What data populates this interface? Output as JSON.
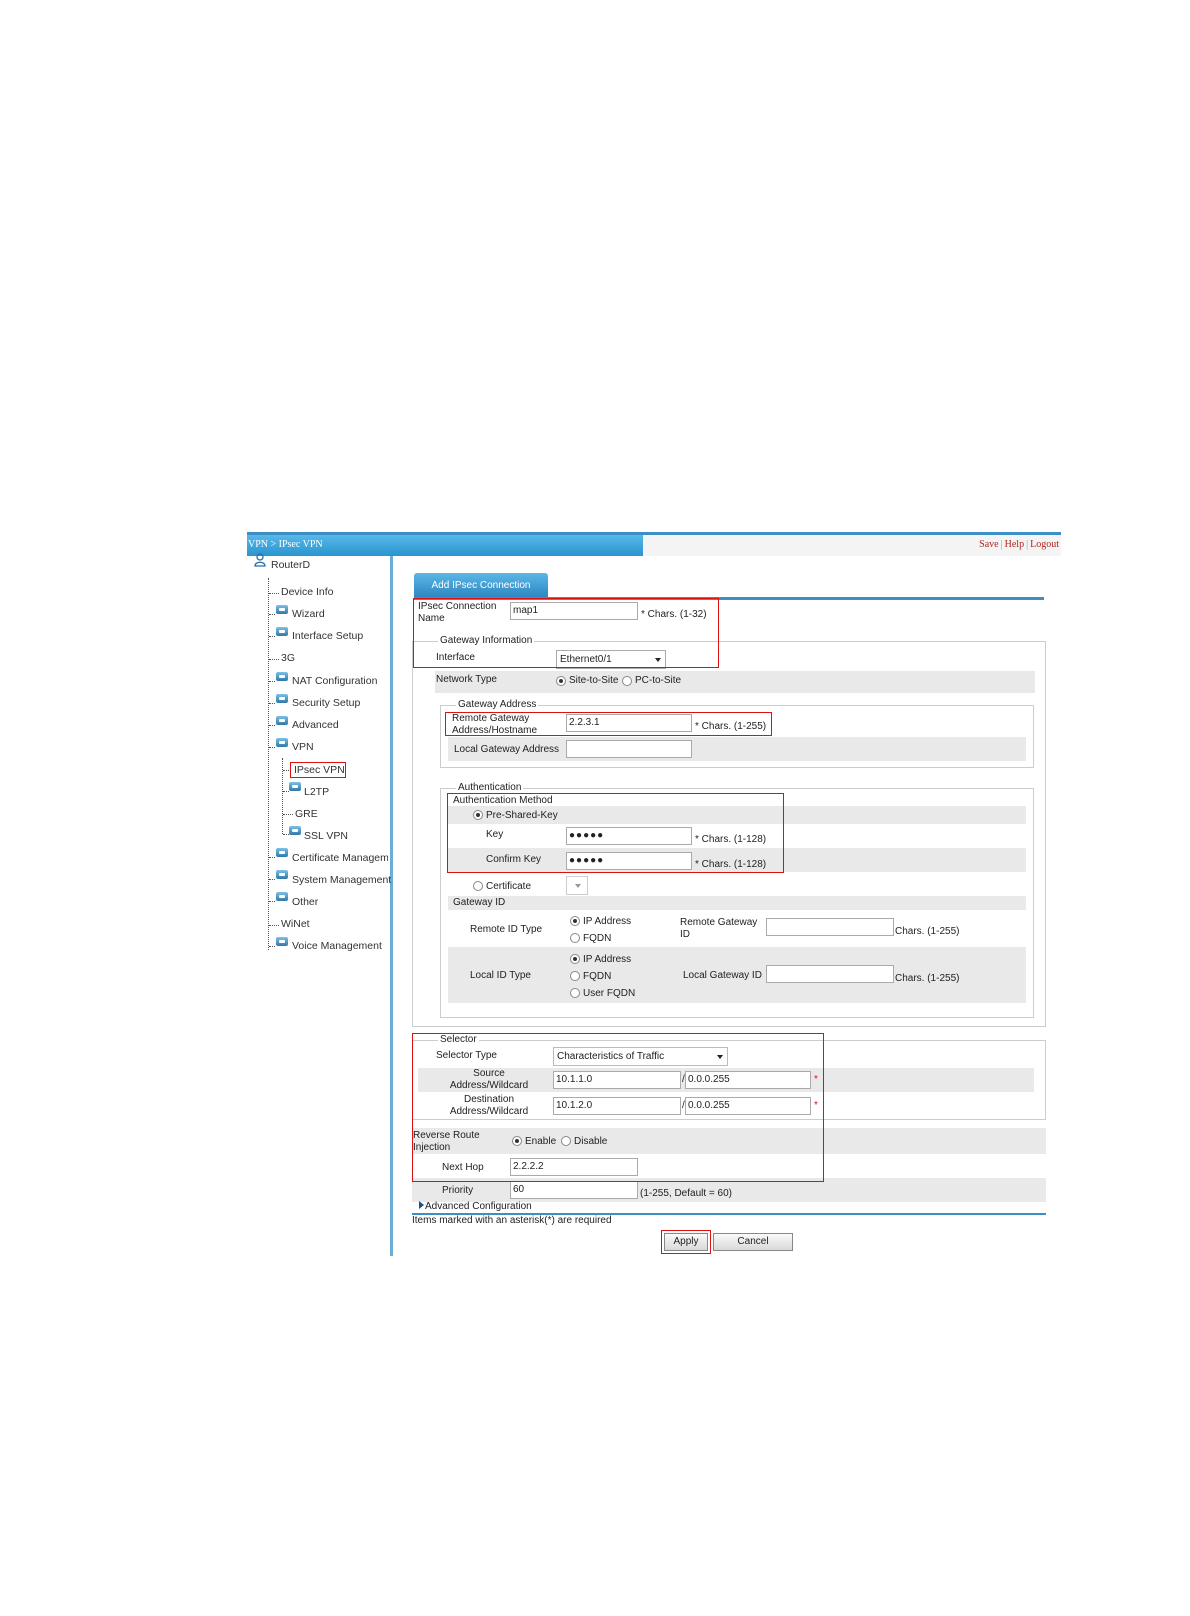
{
  "topbar": {
    "breadcrumb": "VPN > IPsec VPN",
    "links": [
      "Save",
      "Help",
      "Logout"
    ]
  },
  "sidebar": {
    "root": "RouterD",
    "items": [
      {
        "label": "Device Info"
      },
      {
        "label": "Wizard",
        "icon": "folder-icon"
      },
      {
        "label": "Interface Setup",
        "icon": "folder-icon"
      },
      {
        "label": "3G"
      },
      {
        "label": "NAT Configuration",
        "icon": "folder-icon"
      },
      {
        "label": "Security Setup",
        "icon": "folder-icon"
      },
      {
        "label": "Advanced",
        "icon": "folder-icon"
      },
      {
        "label": "VPN",
        "icon": "folder-icon"
      },
      {
        "label": "IPsec VPN",
        "selected": true
      },
      {
        "label": "L2TP",
        "icon": "folder-icon"
      },
      {
        "label": "GRE"
      },
      {
        "label": "SSL VPN",
        "icon": "folder-icon"
      },
      {
        "label": "Certificate Manageme",
        "icon": "folder-icon"
      },
      {
        "label": "System Management",
        "icon": "folder-icon"
      },
      {
        "label": "Other",
        "icon": "folder-icon"
      },
      {
        "label": "WiNet"
      },
      {
        "label": "Voice Management",
        "icon": "folder-icon"
      }
    ]
  },
  "tab": {
    "label": "Add IPsec Connection"
  },
  "form": {
    "conn_name": {
      "label": "IPsec Connection Name",
      "value": "map1",
      "hint": "* Chars. (1-32)"
    },
    "gateway_info": {
      "legend": "Gateway Information"
    },
    "interface": {
      "label": "Interface",
      "value": "Ethernet0/1"
    },
    "network_type": {
      "label": "Network Type",
      "opt1": "Site-to-Site",
      "opt2": "PC-to-Site"
    },
    "gateway_address": {
      "legend": "Gateway Address"
    },
    "remote_gw": {
      "label": "Remote Gateway Address/Hostname",
      "value": "2.2.3.1",
      "hint": "* Chars. (1-255)"
    },
    "local_gw": {
      "label": "Local Gateway Address",
      "value": ""
    },
    "authentication": {
      "legend": "Authentication"
    },
    "auth_method": {
      "label": "Authentication Method",
      "psk": "Pre-Shared-Key",
      "certificate": "Certificate"
    },
    "key": {
      "label": "Key",
      "value": "●●●●●",
      "hint": "* Chars. (1-128)"
    },
    "confirm_key": {
      "label": "Confirm Key",
      "value": "●●●●●",
      "hint": "* Chars. (1-128)"
    },
    "gateway_id": {
      "label": "Gateway ID"
    },
    "remote_id_type": {
      "label": "Remote ID Type",
      "opt1": "IP Address",
      "opt2": "FQDN",
      "gw_label": "Remote Gateway ID",
      "gw_value": "",
      "hint": "Chars. (1-255)"
    },
    "local_id_type": {
      "label": "Local ID Type",
      "opt1": "IP Address",
      "opt2": "FQDN",
      "opt3": "User FQDN",
      "gw_label": "Local Gateway ID",
      "gw_value": "",
      "hint": "Chars. (1-255)"
    },
    "selector": {
      "legend": "Selector"
    },
    "selector_type": {
      "label": "Selector Type",
      "value": "Characteristics of Traffic"
    },
    "source": {
      "label": "Source Address/Wildcard",
      "addr": "10.1.1.0",
      "wildcard": "0.0.0.255",
      "star": "*"
    },
    "destination": {
      "label": "Destination Address/Wildcard",
      "addr": "10.1.2.0",
      "wildcard": "0.0.0.255",
      "star": "*"
    },
    "rri": {
      "label": "Reverse Route Injection",
      "enable": "Enable",
      "disable": "Disable"
    },
    "next_hop": {
      "label": "Next Hop",
      "value": "2.2.2.2"
    },
    "priority": {
      "label": "Priority",
      "value": "60",
      "hint": "(1-255, Default = 60)"
    },
    "advanced": {
      "label": "Advanced Configuration"
    },
    "note": "Items marked with an asterisk(*) are required",
    "apply": "Apply",
    "cancel": "Cancel"
  }
}
